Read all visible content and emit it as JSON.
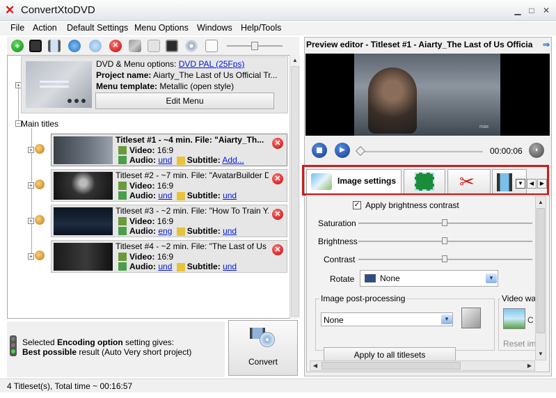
{
  "window": {
    "title": "ConvertXtoDVD",
    "icon": "x-logo-icon"
  },
  "menu": [
    "File",
    "Action",
    "Default Settings",
    "Menu Options",
    "Windows",
    "Help/Tools"
  ],
  "dvd_menu": {
    "options_label": "DVD & Menu options:",
    "options_value": "DVD PAL (25Fps)",
    "project_label": "Project name:",
    "project_value": "Aiarty_The Last of Us  Official Tr...",
    "template_label": "Menu template:",
    "template_value": "Metallic (open style)",
    "edit_button": "Edit Menu"
  },
  "main_titles_label": "Main titles",
  "titlesets": [
    {
      "title": "Titleset #1 - ~4 min. File: \"Aiarty_Th...",
      "video_label": "Video:",
      "video": "16:9",
      "audio_label": "Audio:",
      "audio": "und",
      "subtitle_label": "Subtitle:",
      "subtitle": "Add...",
      "selected": true
    },
    {
      "title": "Titleset #2 - ~7 min. File: \"AvatarBuilder D...",
      "video_label": "Video:",
      "video": "16:9",
      "audio_label": "Audio:",
      "audio": "und",
      "subtitle_label": "Subtitle:",
      "subtitle": "und",
      "selected": false
    },
    {
      "title": "Titleset #3 - ~2 min. File: \"How To Train Y...",
      "video_label": "Video:",
      "video": "16:9",
      "audio_label": "Audio:",
      "audio": "eng",
      "subtitle_label": "Subtitle:",
      "subtitle": "und",
      "selected": false
    },
    {
      "title": "Titleset #4 - ~2 min. File: \"The Last of Us ...",
      "video_label": "Video:",
      "video": "16:9",
      "audio_label": "Audio:",
      "audio": "und",
      "subtitle_label": "Subtitle:",
      "subtitle": "und",
      "selected": false
    }
  ],
  "encoding": {
    "line1_pre": "Selected ",
    "line1_bold": "Encoding option",
    "line1_post": " setting gives:",
    "line2_bold": "Best possible",
    "line2_post": " result (Auto Very short project)"
  },
  "convert_button": "Convert",
  "status": "4 Titleset(s), Total time ~ 00:16:57",
  "preview": {
    "title": "Preview editor - Titleset #1 - Aiarty_The Last of Us  Officia",
    "time": "00:00:06",
    "watermark": "max",
    "seek_fraction": 0.02
  },
  "tabs": [
    {
      "label": "Image settings",
      "icon": "image-settings-icon",
      "active": true
    },
    {
      "label": "",
      "icon": "crop-frame-icon",
      "active": false
    },
    {
      "label": "",
      "icon": "scissors-icon",
      "active": false
    },
    {
      "label": "",
      "icon": "film-strip-icon",
      "active": false
    }
  ],
  "image_settings": {
    "brightness_contrast_label": "Apply brightness contrast",
    "brightness_contrast_checked": true,
    "saturation_label": "Saturation",
    "brightness_label": "Brightness",
    "contrast_label": "Contrast",
    "saturation_value": 0.5,
    "brightness_value": 0.5,
    "contrast_value": 0.5,
    "rotate_label": "Rotate",
    "rotate_value": "None",
    "post_processing_label": "Image post-processing",
    "post_processing_value": "None",
    "video_watermark_label": "Video wate",
    "reset_label": "Reset ima",
    "apply_all_button": "Apply to all titlesets"
  },
  "colors": {
    "highlight_frame": "#d11919",
    "link": "#0018d8"
  }
}
